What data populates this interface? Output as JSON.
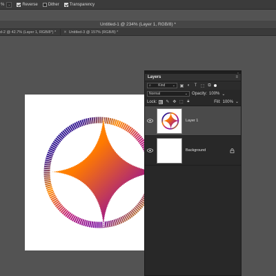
{
  "options_bar": {
    "zoom_fragment": "%",
    "checkboxes": [
      {
        "label": "Reverse",
        "checked": true
      },
      {
        "label": "Dither",
        "checked": false
      },
      {
        "label": "Transparency",
        "checked": true
      }
    ]
  },
  "window": {
    "title": "Untitled-1 @ 234% (Layer 1, RGB/8) *"
  },
  "doc_tabs": [
    {
      "label": "d-2 @ 42.7% (Layer 1, RGB/8*) *"
    },
    {
      "label": "Untitled-3 @ 157% (RGB/8) *"
    }
  ],
  "layers_panel": {
    "title": "Layers",
    "filter": {
      "value": "Kind"
    },
    "blend_mode": "Normal",
    "opacity_label": "Opacity:",
    "opacity_value": "100%",
    "lock_label": "Lock:",
    "fill_label": "Fill:",
    "fill_value": "100%",
    "layers": [
      {
        "name": "Layer 1",
        "visible": true,
        "selected": true,
        "locked": false
      },
      {
        "name": "Background",
        "visible": true,
        "selected": false,
        "locked": true
      }
    ]
  },
  "colors": {
    "gradient_start": "#ff9a00",
    "gradient_mid": "#9b1a86",
    "gradient_end": "#6a0fa8",
    "ring_yellow": "#f2e000",
    "ring_blue": "#1c2aa8",
    "panel_bg": "#282828",
    "workspace_bg": "#535353"
  }
}
